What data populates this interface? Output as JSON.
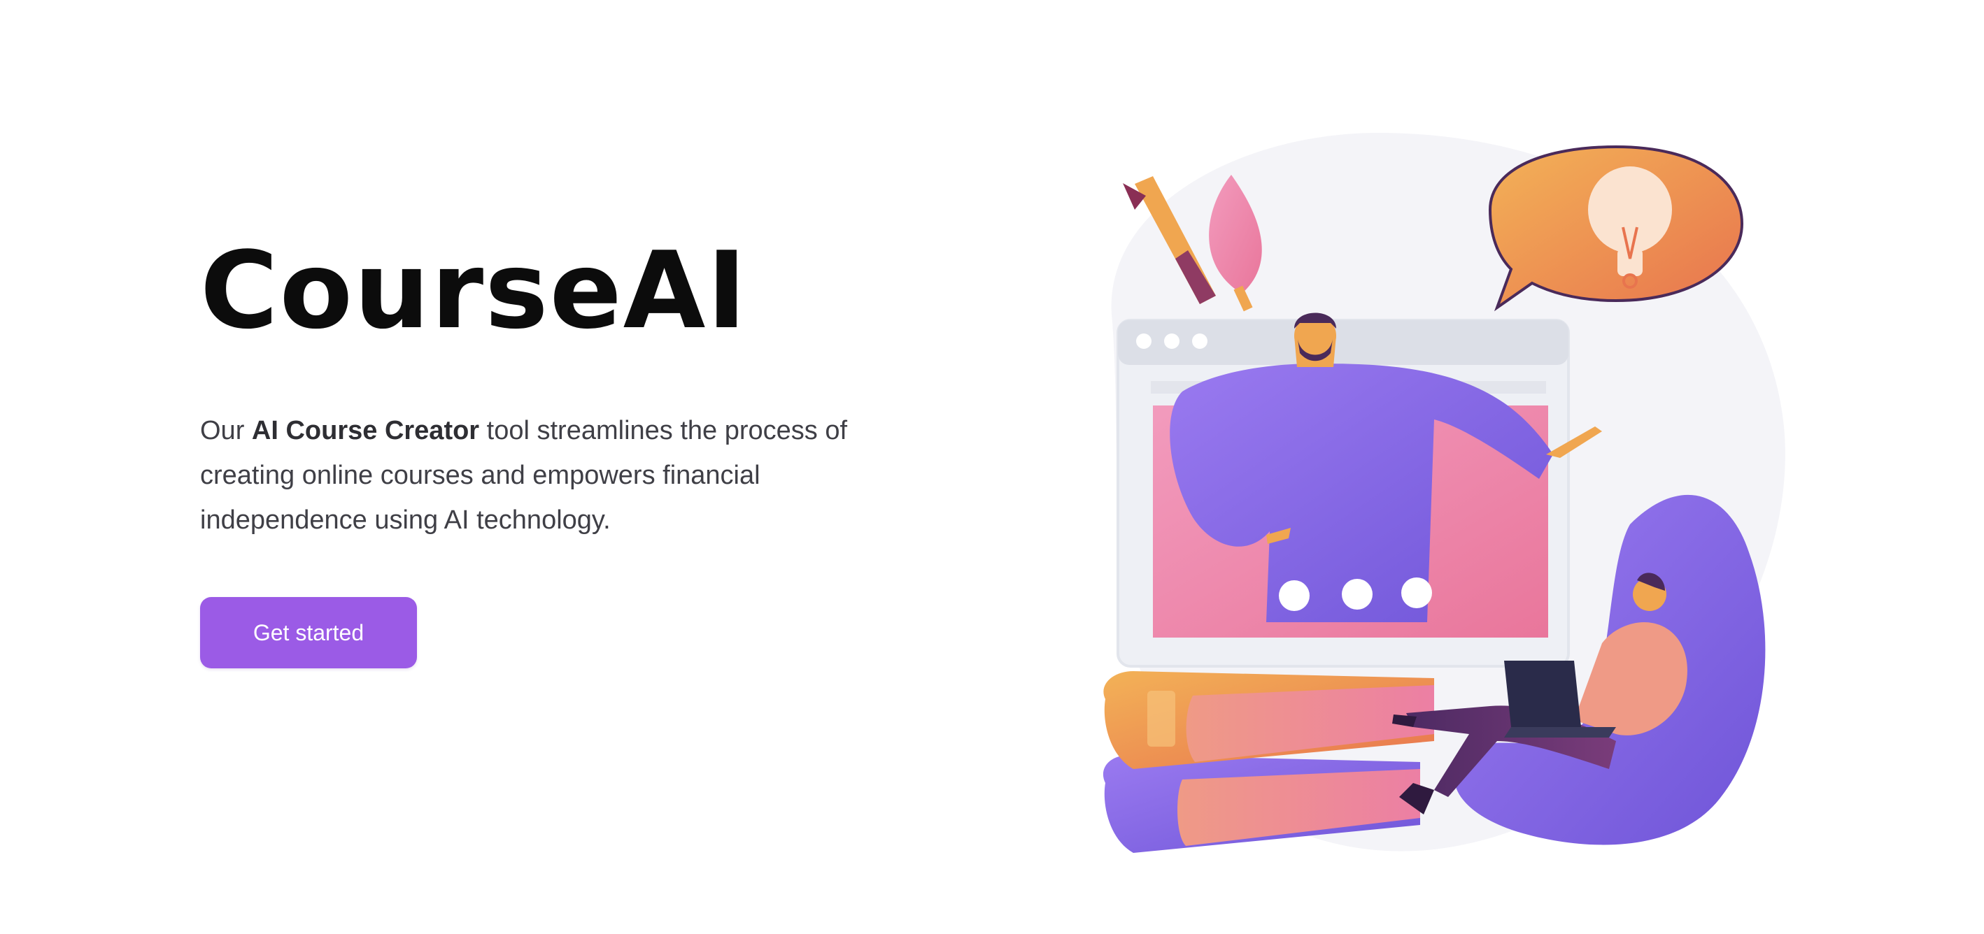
{
  "hero": {
    "title": "CourseAI",
    "description_intro": "Our ",
    "description_bold": "AI Course Creator",
    "description_rest": " tool streamlines the process of creating online courses and empowers financial independence using AI technology.",
    "cta_label": "Get started"
  },
  "colors": {
    "accent": "#9b5be6",
    "title_text": "#0c0c0c",
    "body_text": "#3f3f46",
    "illustration_purple": "#8a6ae6",
    "illustration_pink": "#ee8aa8",
    "illustration_orange": "#f0a050"
  },
  "illustration": {
    "icon": "online-teaching-illustration"
  }
}
